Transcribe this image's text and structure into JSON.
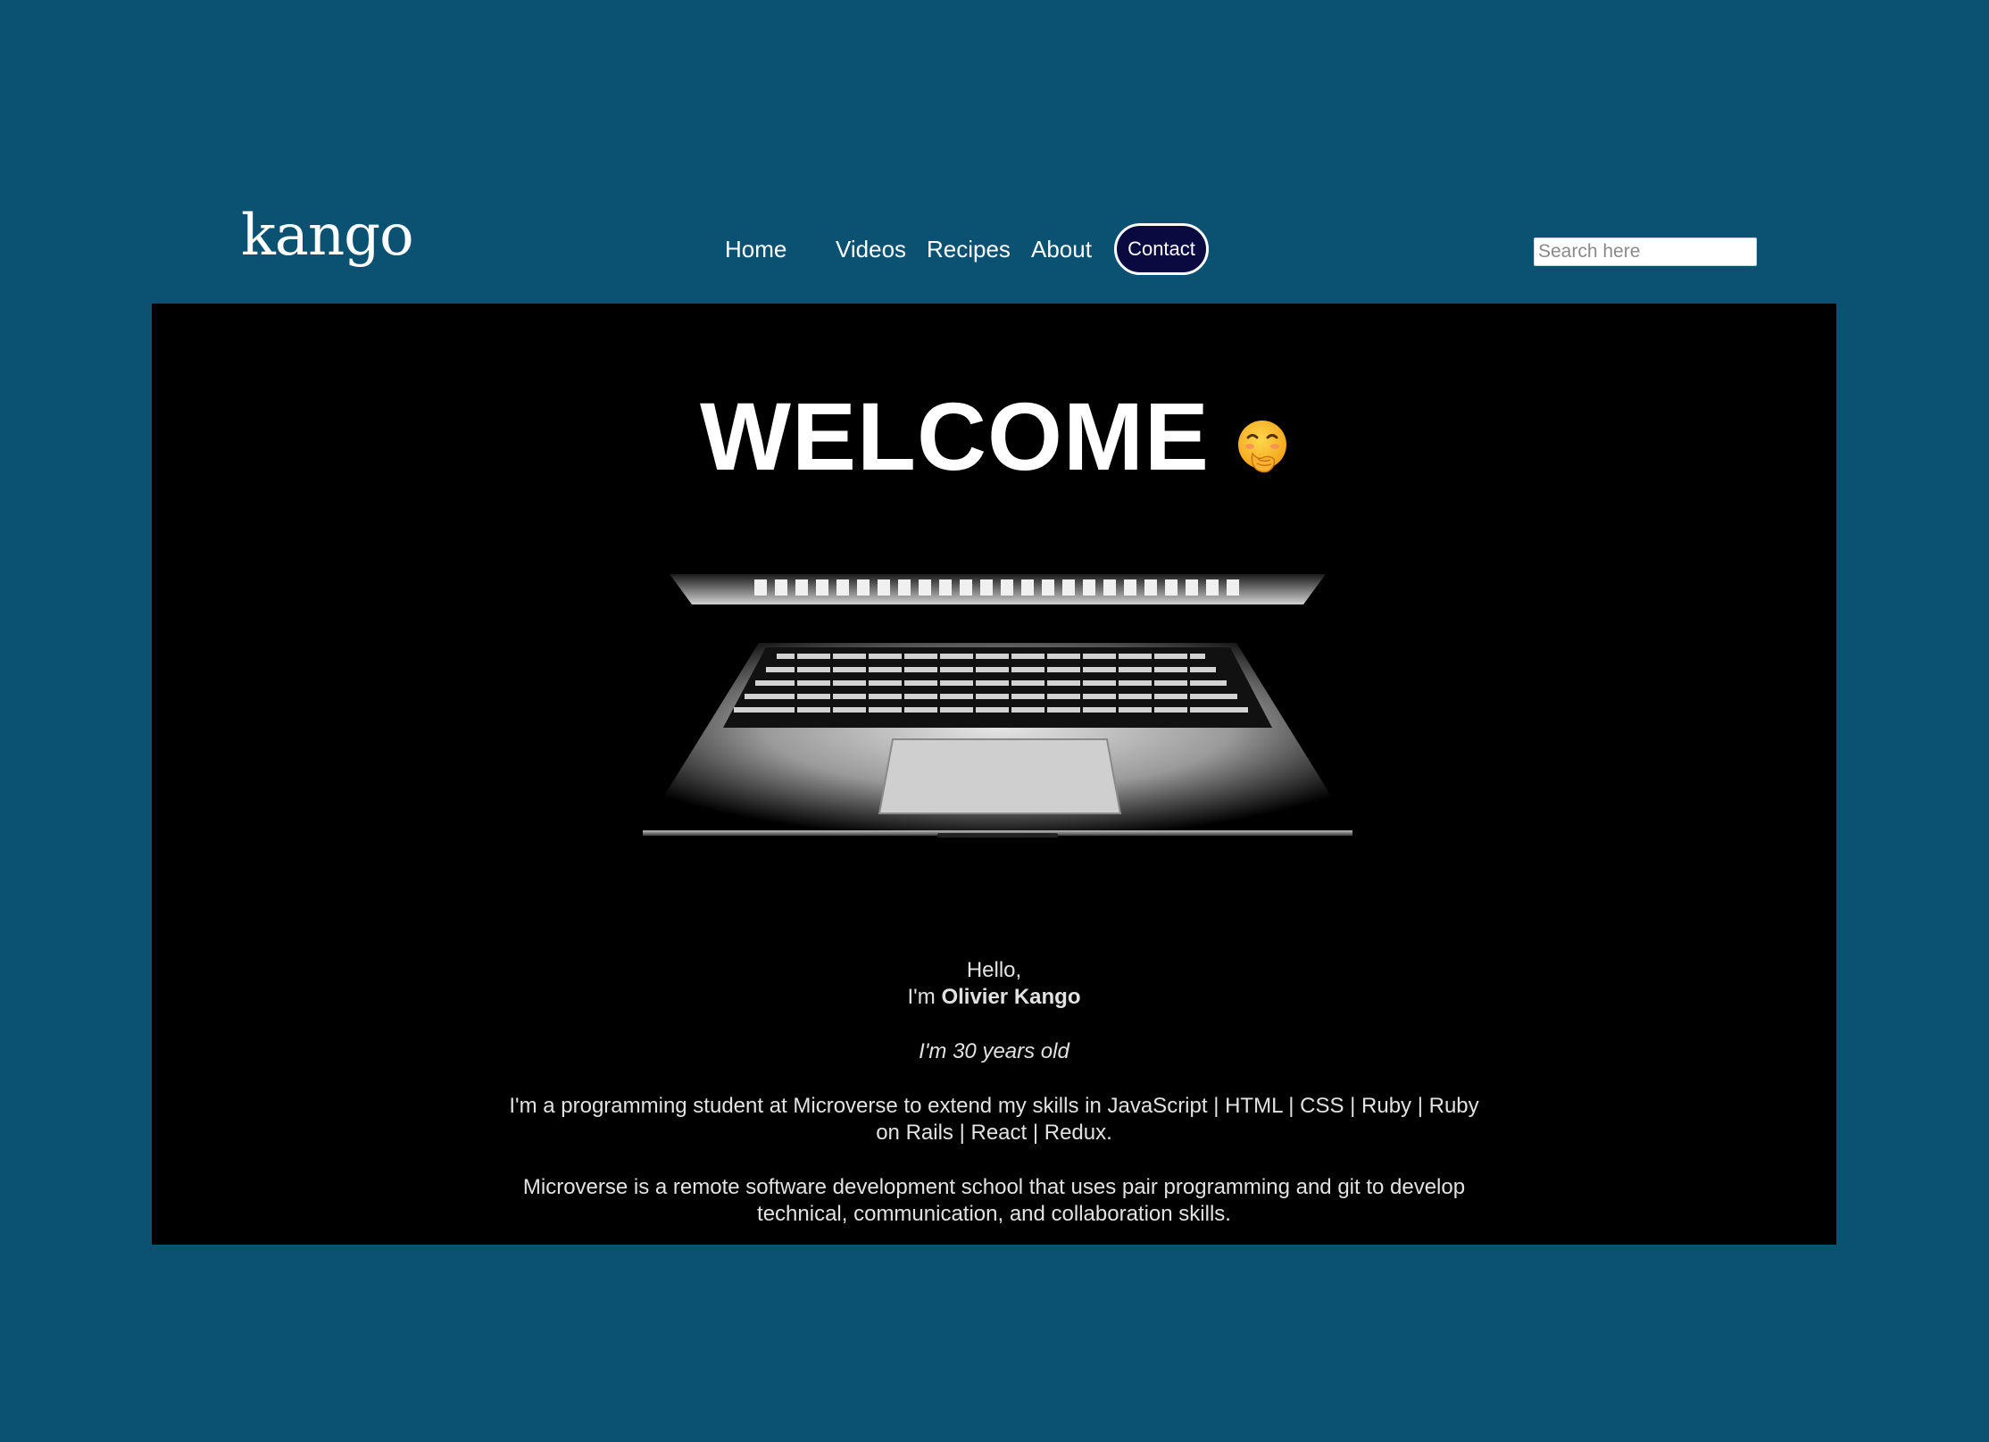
{
  "header": {
    "logo_text": "kango"
  },
  "nav": {
    "items": [
      {
        "label": "Home"
      },
      {
        "label": "Videos"
      },
      {
        "label": "Recipes"
      },
      {
        "label": "About"
      }
    ],
    "contact_label": "Contact"
  },
  "search": {
    "placeholder": "Search here",
    "value": ""
  },
  "hero": {
    "title": "WELCOME",
    "title_emoji": "face-with-hand-over-mouth-icon",
    "greeting": "Hello,",
    "intro_prefix": "I'm",
    "name": "Olivier Kango",
    "age": "I'm 30 years old",
    "bio": "I'm a programming student at Microverse to extend my skills in JavaScript | HTML | CSS | Ruby | Ruby on Rails | React | Redux.",
    "school": "Microverse is a remote software development school that uses pair programming and git to develop technical, communication, and collaboration skills."
  },
  "colors": {
    "page_background": "#0b5272",
    "hero_background": "#000000",
    "contact_button": "#0a0a40",
    "text": "#ffffff"
  }
}
